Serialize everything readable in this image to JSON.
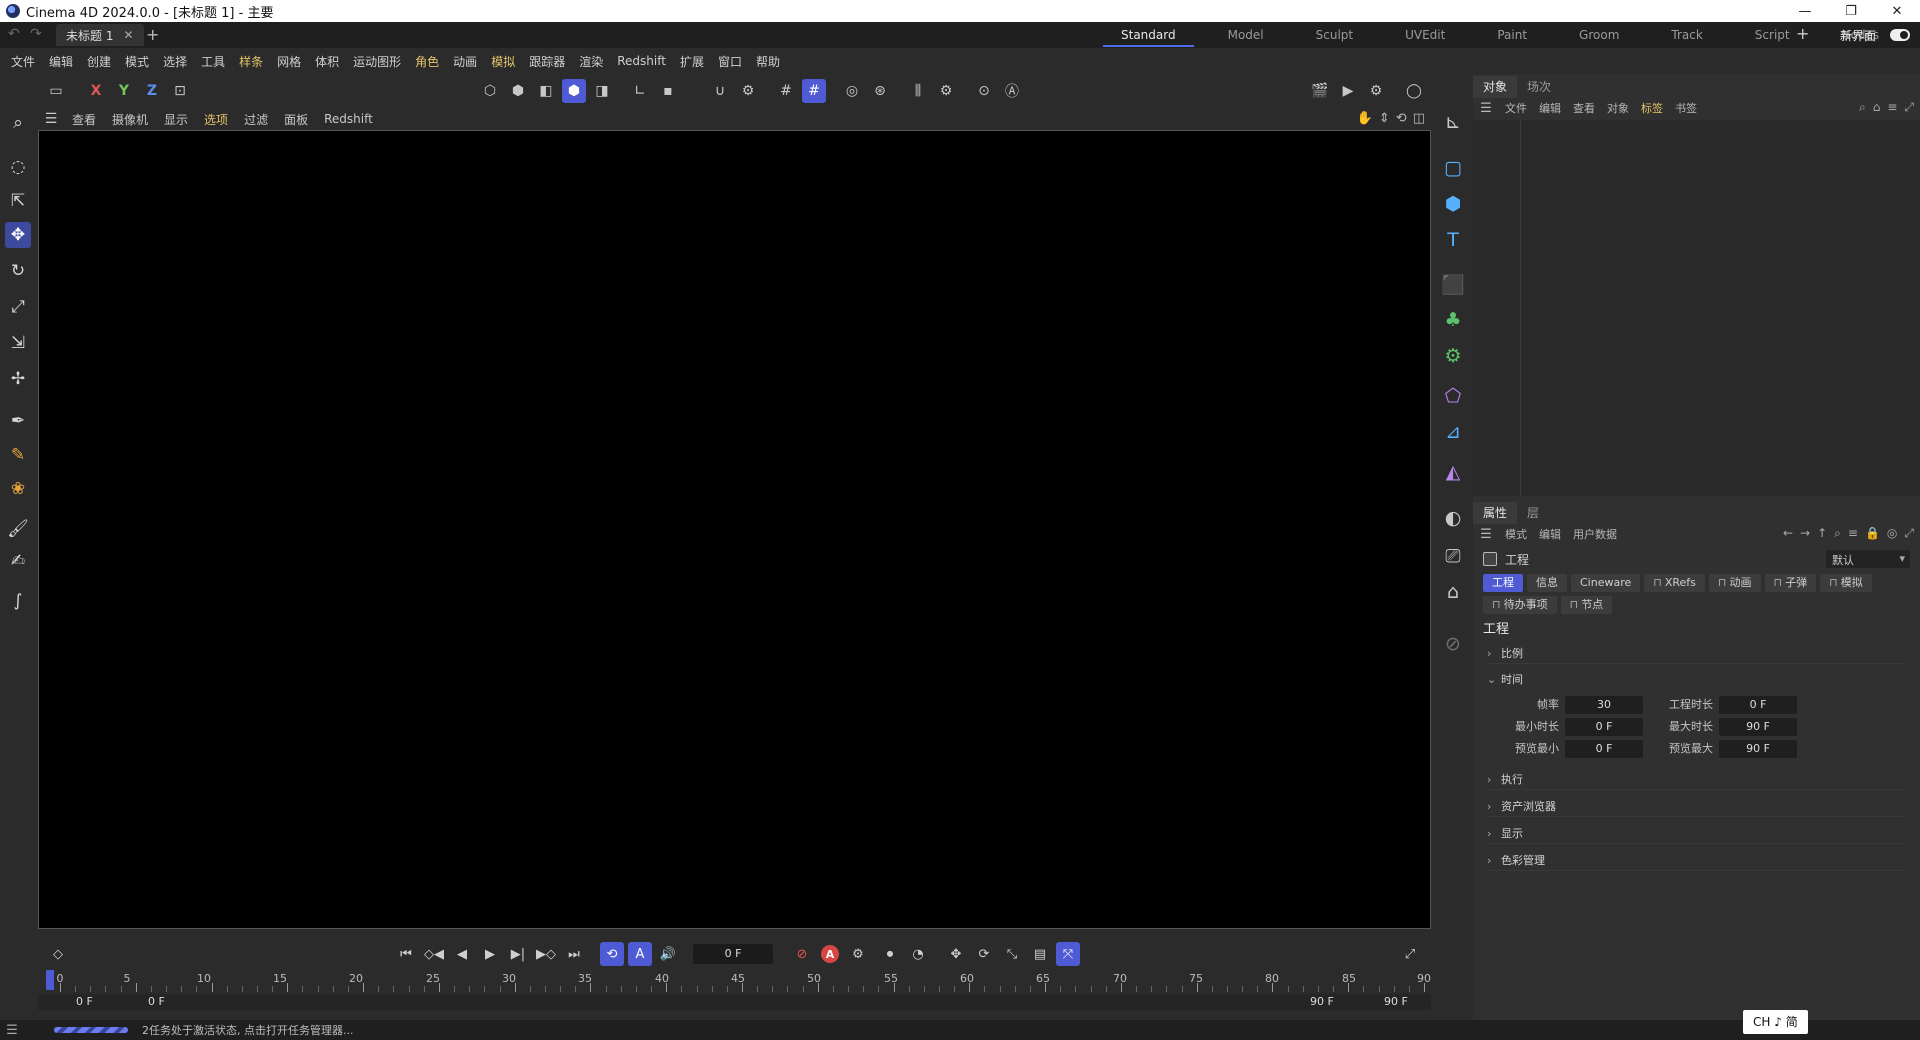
{
  "window": {
    "title": "Cinema 4D 2024.0.0 - [未标题 1] - 主要",
    "min": "—",
    "max": "❐",
    "close": "✕"
  },
  "tabbar": {
    "document_tab": "未标题 1",
    "layouts": [
      "Standard",
      "Model",
      "Sculpt",
      "UVEdit",
      "Paint",
      "Groom",
      "Track",
      "Script",
      "Nodes"
    ],
    "active_layout": "Standard",
    "new_ui_label": "新界面"
  },
  "menubar": {
    "items": [
      "文件",
      "编辑",
      "创建",
      "模式",
      "选择",
      "工具",
      "样条",
      "网格",
      "体积",
      "运动图形",
      "角色",
      "动画",
      "模拟",
      "跟踪器",
      "渲染",
      "Redshift",
      "扩展",
      "窗口",
      "帮助"
    ],
    "highlighted": [
      "样条",
      "角色",
      "模拟"
    ]
  },
  "toolbar": {
    "axis_x": "X",
    "axis_y": "Y",
    "axis_z": "Z"
  },
  "viewport": {
    "menu": [
      "查看",
      "摄像机",
      "显示",
      "选项",
      "过滤",
      "面板",
      "Redshift"
    ],
    "highlighted": "选项"
  },
  "objects_panel": {
    "tabs": [
      "对象",
      "场次"
    ],
    "menu": [
      "文件",
      "编辑",
      "查看",
      "对象",
      "标签",
      "书签"
    ],
    "highlighted": "标签"
  },
  "attributes_panel": {
    "tabs": [
      "属性",
      "层"
    ],
    "menu": [
      "模式",
      "编辑",
      "用户数据"
    ],
    "object_name": "工程",
    "preset": "默认",
    "buttons_row1": [
      "工程",
      "信息",
      "Cineware",
      "XRefs",
      "动画",
      "子弹",
      "模拟"
    ],
    "buttons_row2": [
      "待办事项",
      "节点"
    ],
    "section_title": "工程",
    "sections": {
      "scale": "比例",
      "time": "时间",
      "execute": "执行",
      "asset_browser": "资产浏览器",
      "display": "显示",
      "color_mgmt": "色彩管理"
    },
    "time_fields": {
      "fps_label": "帧率",
      "fps": "30",
      "project_len_label": "工程时长",
      "project_len": "0 F",
      "min_time_label": "最小时长",
      "min_time": "0 F",
      "max_time_label": "最大时长",
      "max_time": "90 F",
      "preview_min_label": "预览最小",
      "preview_min": "0 F",
      "preview_max_label": "预览最大",
      "preview_max": "90 F"
    }
  },
  "timeline": {
    "current_frame": "0 F",
    "ruler_labels": [
      "0",
      "5",
      "10",
      "15",
      "20",
      "25",
      "30",
      "35",
      "40",
      "45",
      "50",
      "55",
      "60",
      "65",
      "70",
      "75",
      "80",
      "85",
      "90"
    ],
    "start_field": "0 F",
    "preview_start": "0 F",
    "preview_end": "90 F",
    "end_field": "90 F",
    "record_label": "A"
  },
  "statusbar": {
    "text": "2任务处于激活状态, 点击打开任务管理器..."
  },
  "ime": {
    "label": "CH ♪ 简"
  }
}
